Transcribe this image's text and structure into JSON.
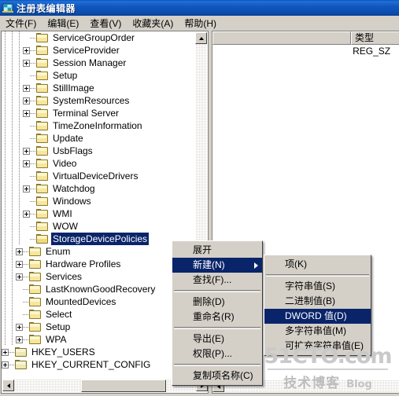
{
  "window": {
    "title": "注册表编辑器",
    "icon": "registry-editor-icon"
  },
  "menubar": {
    "items": [
      {
        "label": "文件(F)",
        "name": "menu-file"
      },
      {
        "label": "编辑(E)",
        "name": "menu-edit"
      },
      {
        "label": "查看(V)",
        "name": "menu-view"
      },
      {
        "label": "收藏夹(A)",
        "name": "menu-favorites"
      },
      {
        "label": "帮助(H)",
        "name": "menu-help"
      }
    ]
  },
  "tree": {
    "nodes": [
      {
        "label": "ServiceGroupOrder",
        "indent": 3,
        "expander": "none",
        "selected": false,
        "icon": "folder-icon"
      },
      {
        "label": "ServiceProvider",
        "indent": 3,
        "expander": "plus",
        "selected": false,
        "icon": "folder-icon"
      },
      {
        "label": "Session Manager",
        "indent": 3,
        "expander": "plus",
        "selected": false,
        "icon": "folder-icon"
      },
      {
        "label": "Setup",
        "indent": 3,
        "expander": "none",
        "selected": false,
        "icon": "folder-icon"
      },
      {
        "label": "StillImage",
        "indent": 3,
        "expander": "plus",
        "selected": false,
        "icon": "folder-icon"
      },
      {
        "label": "SystemResources",
        "indent": 3,
        "expander": "plus",
        "selected": false,
        "icon": "folder-icon"
      },
      {
        "label": "Terminal Server",
        "indent": 3,
        "expander": "plus",
        "selected": false,
        "icon": "folder-icon"
      },
      {
        "label": "TimeZoneInformation",
        "indent": 3,
        "expander": "none",
        "selected": false,
        "icon": "folder-icon"
      },
      {
        "label": "Update",
        "indent": 3,
        "expander": "none",
        "selected": false,
        "icon": "folder-icon"
      },
      {
        "label": "UsbFlags",
        "indent": 3,
        "expander": "plus",
        "selected": false,
        "icon": "folder-icon"
      },
      {
        "label": "Video",
        "indent": 3,
        "expander": "plus",
        "selected": false,
        "icon": "folder-icon"
      },
      {
        "label": "VirtualDeviceDrivers",
        "indent": 3,
        "expander": "none",
        "selected": false,
        "icon": "folder-icon"
      },
      {
        "label": "Watchdog",
        "indent": 3,
        "expander": "plus",
        "selected": false,
        "icon": "folder-icon"
      },
      {
        "label": "Windows",
        "indent": 3,
        "expander": "none",
        "selected": false,
        "icon": "folder-icon"
      },
      {
        "label": "WMI",
        "indent": 3,
        "expander": "plus",
        "selected": false,
        "icon": "folder-icon"
      },
      {
        "label": "WOW",
        "indent": 3,
        "expander": "none",
        "selected": false,
        "icon": "folder-icon"
      },
      {
        "label": "StorageDevicePolicies",
        "indent": 3,
        "expander": "none",
        "selected": true,
        "icon": "folder-open-icon"
      },
      {
        "label": "Enum",
        "indent": 2,
        "expander": "plus",
        "selected": false,
        "icon": "folder-icon"
      },
      {
        "label": "Hardware Profiles",
        "indent": 2,
        "expander": "plus",
        "selected": false,
        "icon": "folder-icon"
      },
      {
        "label": "Services",
        "indent": 2,
        "expander": "plus",
        "selected": false,
        "icon": "folder-icon"
      },
      {
        "label": "LastKnownGoodRecovery",
        "indent": 2,
        "expander": "none",
        "selected": false,
        "icon": "folder-icon"
      },
      {
        "label": "MountedDevices",
        "indent": 2,
        "expander": "none",
        "selected": false,
        "icon": "folder-icon"
      },
      {
        "label": "Select",
        "indent": 2,
        "expander": "none",
        "selected": false,
        "icon": "folder-icon"
      },
      {
        "label": "Setup",
        "indent": 2,
        "expander": "plus",
        "selected": false,
        "icon": "folder-icon"
      },
      {
        "label": "WPA",
        "indent": 2,
        "expander": "plus",
        "selected": false,
        "icon": "folder-icon"
      },
      {
        "label": "HKEY_USERS",
        "indent": 0,
        "expander": "plus",
        "selected": false,
        "icon": "folder-root-icon"
      },
      {
        "label": "HKEY_CURRENT_CONFIG",
        "indent": 0,
        "expander": "plus",
        "selected": false,
        "icon": "folder-root-icon"
      }
    ]
  },
  "list": {
    "columns": [
      {
        "label": "",
        "name": "column-name",
        "width": 176
      },
      {
        "label": "类型",
        "name": "column-type",
        "width": 62
      }
    ],
    "rows": [
      {
        "name": "",
        "type": "REG_SZ"
      }
    ]
  },
  "context_menu": {
    "items": [
      {
        "label": "展开",
        "name": "context-expand",
        "selected": false,
        "separator_after": false,
        "submenu": false
      },
      {
        "label": "新建(N)",
        "name": "context-new",
        "selected": true,
        "separator_after": false,
        "submenu": true
      },
      {
        "label": "查找(F)...",
        "name": "context-find",
        "selected": false,
        "separator_after": true,
        "submenu": false
      },
      {
        "label": "删除(D)",
        "name": "context-delete",
        "selected": false,
        "separator_after": false,
        "submenu": false
      },
      {
        "label": "重命名(R)",
        "name": "context-rename",
        "selected": false,
        "separator_after": true,
        "submenu": false
      },
      {
        "label": "导出(E)",
        "name": "context-export",
        "selected": false,
        "separator_after": false,
        "submenu": false
      },
      {
        "label": "权限(P)...",
        "name": "context-permissions",
        "selected": false,
        "separator_after": true,
        "submenu": false
      },
      {
        "label": "复制项名称(C)",
        "name": "context-copy-key-name",
        "selected": false,
        "separator_after": false,
        "submenu": false
      }
    ]
  },
  "submenu": {
    "items": [
      {
        "label": "项(K)",
        "name": "submenu-key",
        "selected": false,
        "separator_after": true
      },
      {
        "label": "字符串值(S)",
        "name": "submenu-string-value",
        "selected": false,
        "separator_after": false
      },
      {
        "label": "二进制值(B)",
        "name": "submenu-binary-value",
        "selected": false,
        "separator_after": false
      },
      {
        "label": "DWORD 值(D)",
        "name": "submenu-dword-value",
        "selected": true,
        "separator_after": false
      },
      {
        "label": "多字符串值(M)",
        "name": "submenu-multi-string-value",
        "selected": false,
        "separator_after": false
      },
      {
        "label": "可扩充字符串值(E)",
        "name": "submenu-expandable-string-value",
        "selected": false,
        "separator_after": false
      }
    ]
  },
  "watermark": {
    "site": "51CTO.com",
    "cn": "技术博客",
    "blog": "Blog"
  },
  "colors": {
    "selection": "#0a246a",
    "face": "#d4d0c8",
    "titlebar": "#0b4aa8"
  }
}
